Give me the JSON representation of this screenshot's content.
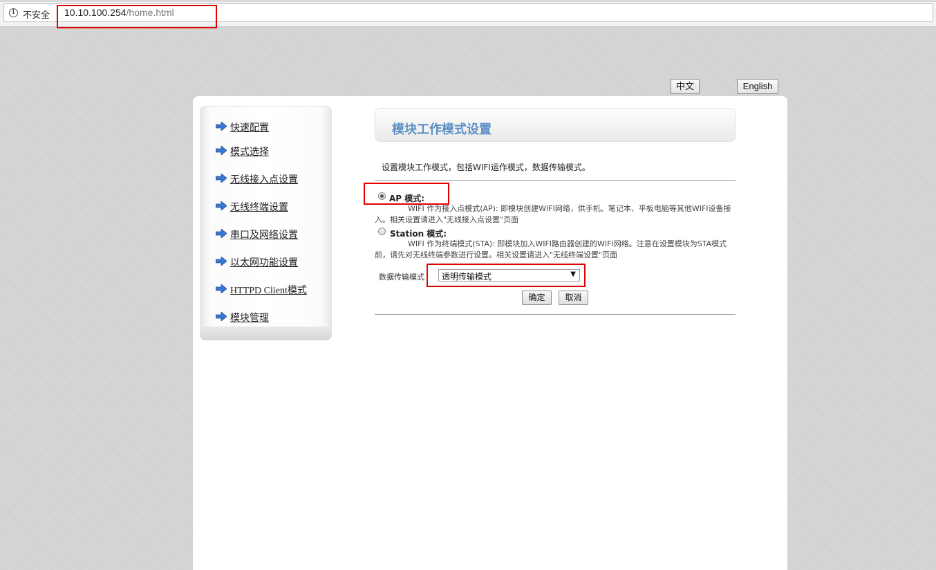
{
  "browser": {
    "security_label": "不安全",
    "url_host": "10.10.100.254",
    "url_path": "/home.html"
  },
  "language": {
    "chinese_label": "中文",
    "english_label": "English"
  },
  "sidebar": {
    "items": [
      {
        "label": "快速配置"
      },
      {
        "label": "模式选择"
      },
      {
        "label": "无线接入点设置"
      },
      {
        "label": "无线终端设置"
      },
      {
        "label": "串口及网络设置"
      },
      {
        "label": "以太网功能设置"
      },
      {
        "label": "HTTPD Client模式"
      },
      {
        "label": "模块管理"
      }
    ],
    "arrow_color": "#3a78d0"
  },
  "main": {
    "title": "模块工作模式设置",
    "description": "设置模块工作模式，包括WIFI运作模式，数据传输模式。",
    "modes": [
      {
        "label": "AP 模式:",
        "selected": true,
        "description": "WIFI 作为接入点模式(AP): 即模块创建WIFI网络，供手机、笔记本、平板电脑等其他WIFI设备接入。相关设置请进入\"无线接入点设置\"页面"
      },
      {
        "label": "Station 模式:",
        "selected": false,
        "description": "WIFI 作为终端模式(STA): 即模块加入WIFI路由器创建的WIFI网络。注意在设置模块为STA模式前，请先对无线终端参数进行设置。相关设置请进入\"无线终端设置\"页面"
      }
    ],
    "transfer_mode_label": "数据传输模式",
    "transfer_mode_value": "透明传输模式",
    "ok_label": "确定",
    "cancel_label": "取消",
    "title_color": "#5b8fc4",
    "highlight_color": "#e20000"
  }
}
